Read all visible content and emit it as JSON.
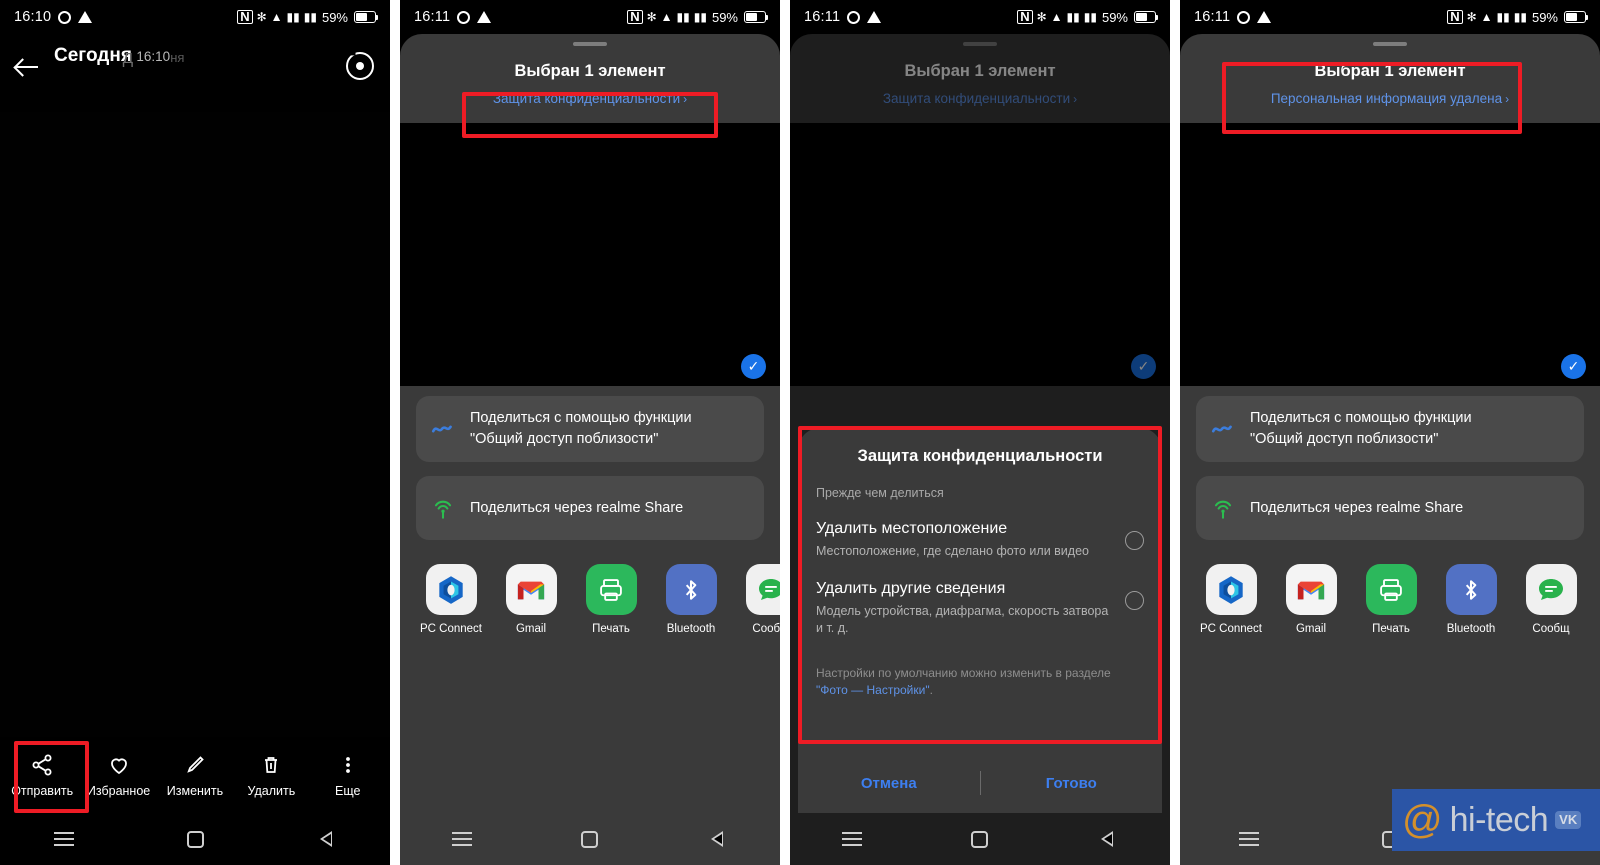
{
  "meta": {
    "panel_count": 4,
    "accent_blue": "#5f93e8",
    "action_blue": "#3d7ff0",
    "highlight_red": "#ee1c25",
    "sheet_bg": "#3a3a3a",
    "card_bg": "#4a4a4a"
  },
  "status_bars": [
    {
      "time": "16:10",
      "battery_pct": "59%",
      "icons": [
        "gear-icon",
        "warning-triangle-icon",
        "nfc-icon",
        "bluetooth-icon",
        "wifi-icon",
        "signal-icon",
        "signal-icon",
        "battery-icon"
      ]
    },
    {
      "time": "16:11",
      "battery_pct": "59%",
      "icons": [
        "gear-icon",
        "warning-triangle-icon",
        "nfc-icon",
        "bluetooth-icon",
        "wifi-icon",
        "signal-icon",
        "signal-icon",
        "battery-icon"
      ]
    },
    {
      "time": "16:11",
      "battery_pct": "59%",
      "icons": [
        "gear-icon",
        "warning-triangle-icon",
        "nfc-icon",
        "bluetooth-icon",
        "wifi-icon",
        "signal-icon",
        "signal-icon",
        "battery-icon"
      ]
    },
    {
      "time": "16:11",
      "battery_pct": "59%",
      "icons": [
        "gear-icon",
        "warning-triangle-icon",
        "nfc-icon",
        "bluetooth-icon",
        "wifi-icon",
        "signal-icon",
        "signal-icon",
        "battery-icon"
      ]
    }
  ],
  "panel1": {
    "header": {
      "title": "Сегодня",
      "title_ghost": "д",
      "subtitle": "16:10",
      "subtitle_ghost": "ня",
      "back_icon": "back-arrow-icon",
      "lens_icon": "google-lens-icon"
    },
    "toolbar": [
      {
        "label": "Отправить",
        "icon": "share-icon",
        "highlighted": true
      },
      {
        "label": "Избранное",
        "icon": "heart-icon",
        "highlighted": false
      },
      {
        "label": "Изменить",
        "icon": "pencil-icon",
        "highlighted": false
      },
      {
        "label": "Удалить",
        "icon": "trash-icon",
        "highlighted": false
      },
      {
        "label": "Еще",
        "icon": "more-vertical-icon",
        "highlighted": false
      }
    ]
  },
  "share_sheet": {
    "title": "Выбран 1 элемент",
    "link_privacy": "Защита конфиденциальности",
    "link_removed": "Персональная информация удалена",
    "chevron": "›",
    "selected_check": "✓",
    "rows": [
      {
        "icon": "nearby-share-icon",
        "text": "Поделиться с помощью функции\n\"Общий доступ поблизости\"",
        "line1": "Поделиться с помощью функции",
        "line2": "\"Общий доступ поблизости\""
      },
      {
        "icon": "realme-share-icon",
        "text": "Поделиться через realme Share",
        "line1": "Поделиться через realme Share",
        "line2": ""
      }
    ],
    "apps": [
      {
        "label": "PC Connect",
        "icon": "pc-connect-icon"
      },
      {
        "label": "Gmail",
        "icon": "gmail-icon"
      },
      {
        "label": "Печать",
        "icon": "printer-icon"
      },
      {
        "label": "Bluetooth",
        "icon": "bluetooth-icon"
      },
      {
        "label": "Сообщ",
        "icon": "messages-icon"
      }
    ]
  },
  "privacy_dialog": {
    "title": "Защита конфиденциальности",
    "subtitle": "Прежде чем делиться",
    "options": [
      {
        "title": "Удалить местоположение",
        "desc": "Местоположение, где сделано фото или видео",
        "selected": false
      },
      {
        "title": "Удалить другие сведения",
        "desc": "Модель устройства, диафрагма, скорость затвора и т. д.",
        "selected": false
      }
    ],
    "note_text": "Настройки по умолчанию можно изменить в разделе ",
    "note_link": "\"Фото — Настройки\"",
    "note_tail": ".",
    "cancel": "Отмена",
    "done": "Готово"
  },
  "navbar": {
    "recents": "recents-icon",
    "home": "home-icon",
    "back": "back-triangle-icon"
  },
  "watermark": {
    "at": "@",
    "text": "hi-tech",
    "badge": "VK"
  }
}
